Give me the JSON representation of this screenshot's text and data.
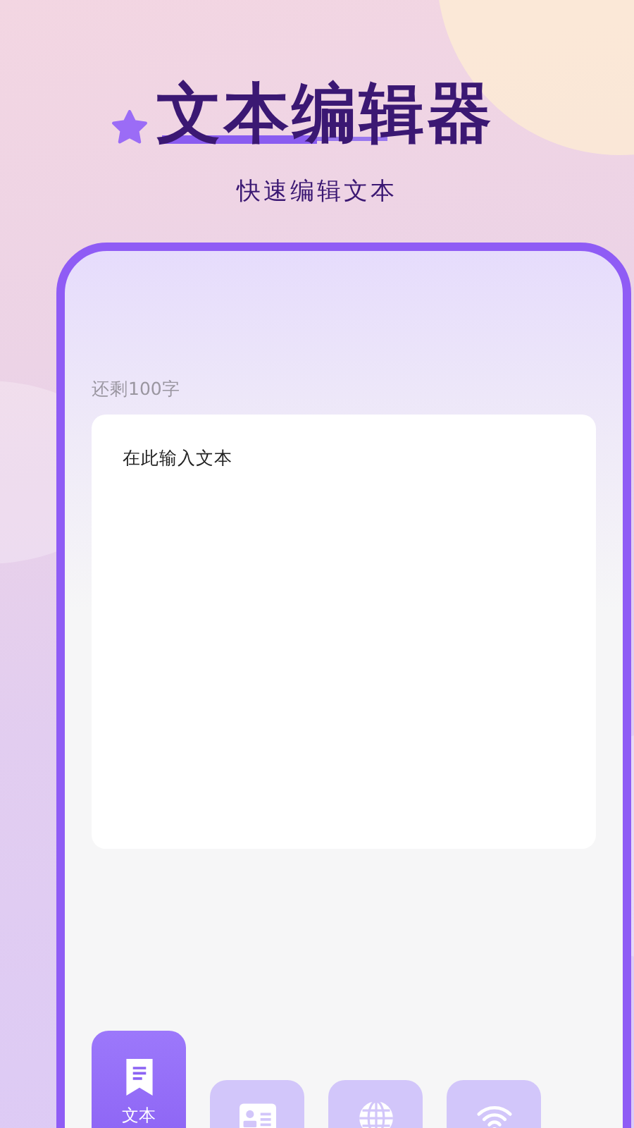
{
  "header": {
    "title": "文本编辑器",
    "subtitle": "快速编辑文本"
  },
  "editor": {
    "remaining": "还剩100字",
    "placeholder": "在此输入文本"
  },
  "tabs": [
    {
      "kind": "document",
      "label": "文本",
      "selected": true
    },
    {
      "kind": "card",
      "selected": false
    },
    {
      "kind": "globe",
      "selected": false
    },
    {
      "kind": "wifi",
      "selected": false
    }
  ]
}
